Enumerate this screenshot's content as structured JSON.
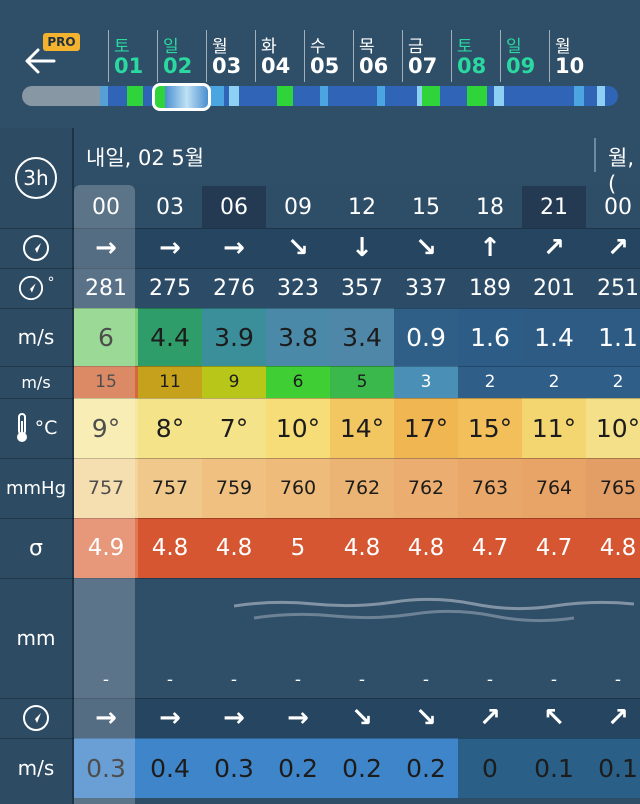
{
  "header": {
    "back_label": "←",
    "pro_badge": "PRO",
    "days": [
      {
        "wd": "토",
        "num": "01",
        "green": true
      },
      {
        "wd": "일",
        "num": "02",
        "green": true
      },
      {
        "wd": "월",
        "num": "03",
        "green": false
      },
      {
        "wd": "화",
        "num": "04",
        "green": false
      },
      {
        "wd": "수",
        "num": "05",
        "green": false
      },
      {
        "wd": "목",
        "num": "06",
        "green": false
      },
      {
        "wd": "금",
        "num": "07",
        "green": false
      },
      {
        "wd": "토",
        "num": "08",
        "green": true
      },
      {
        "wd": "일",
        "num": "09",
        "green": true
      },
      {
        "wd": "월",
        "num": "10",
        "green": false
      }
    ]
  },
  "grid": {
    "interval_label": "3h",
    "date_heading": "내일, 02 5월",
    "next_date_heading": "월, (",
    "hours": [
      "00",
      "03",
      "06",
      "09",
      "12",
      "15",
      "18",
      "21",
      "00"
    ],
    "row_labels": {
      "wind_dir": "◎",
      "wind_deg_icon": "◎",
      "wind_deg_unit": "°",
      "wind_speed": "m/s",
      "gust": "m/s",
      "temp": "°C",
      "pressure": "mmHg",
      "cloud": "σ",
      "precip": "mm",
      "wave_dir": "◎",
      "wave_speed": "m/s"
    },
    "wind_dir_arrows": [
      "→",
      "→",
      "→",
      "↘",
      "↓",
      "↘",
      "↑",
      "↗",
      "↗"
    ],
    "wind_degrees": [
      "281",
      "275",
      "276",
      "323",
      "357",
      "337",
      "189",
      "201",
      "251"
    ],
    "wind_speed": [
      "6",
      "4.4",
      "3.9",
      "3.8",
      "3.4",
      "0.9",
      "1.6",
      "1.4",
      "1.1"
    ],
    "gust": [
      "15",
      "11",
      "9",
      "6",
      "5",
      "3",
      "2",
      "2",
      "2"
    ],
    "temp": [
      "9°",
      "8°",
      "7°",
      "10°",
      "14°",
      "17°",
      "15°",
      "11°",
      "10°"
    ],
    "pressure": [
      "757",
      "757",
      "759",
      "760",
      "762",
      "762",
      "763",
      "764",
      "765"
    ],
    "cloud": [
      "4.9",
      "4.8",
      "4.8",
      "5",
      "4.8",
      "4.8",
      "4.7",
      "4.7",
      "4.8"
    ],
    "precip": [
      "-",
      "-",
      "-",
      "-",
      "-",
      "-",
      "-",
      "-",
      "-"
    ],
    "wave_arrows": [
      "→",
      "→",
      "→",
      "→",
      "↘",
      "↘",
      "↗",
      "↖",
      "↗"
    ],
    "wave_speed": [
      "0.3",
      "0.4",
      "0.3",
      "0.2",
      "0.2",
      "0.2",
      "0",
      "0.1",
      "0.1"
    ]
  },
  "colors": {
    "wind_speed_bg": [
      "#7fcf7a",
      "#2f9d6a",
      "#3a8f9a",
      "#4a89a8",
      "#4e87a8",
      "#2f5f86",
      "#2d5d86",
      "#2d5b83",
      "#2d5b83"
    ],
    "gust_bg": [
      "#d36a3c",
      "#c6a21c",
      "#b8c61a",
      "#3fcf34",
      "#3bb84b",
      "#4a8fb5",
      "#2f5f88",
      "#2f5f88",
      "#2f5f88"
    ],
    "temp_bg": [
      "#f6e8a0",
      "#f5e38a",
      "#f5e38a",
      "#f6dd78",
      "#f2c660",
      "#f0b652",
      "#f2bf5a",
      "#f3d670",
      "#f5e08a"
    ],
    "pressure_bg": [
      "#f3d59a",
      "#f1c88c",
      "#efc080",
      "#eebb7a",
      "#ecb474",
      "#ebae70",
      "#e9a86a",
      "#e8a366",
      "#e39e66"
    ],
    "cloud_bg": [
      "#e07a55",
      "#d55630",
      "#d55630",
      "#d55630",
      "#d55630",
      "#d55630",
      "#d55630",
      "#d55630",
      "#d55630"
    ],
    "wave_speed_bg": [
      "#3f85c9",
      "#3f85c9",
      "#3f85c9",
      "#3f85c9",
      "#3f85c9",
      "#3f85c9",
      "#2a5f88",
      "#2a5f88",
      "#2a5f88"
    ]
  }
}
